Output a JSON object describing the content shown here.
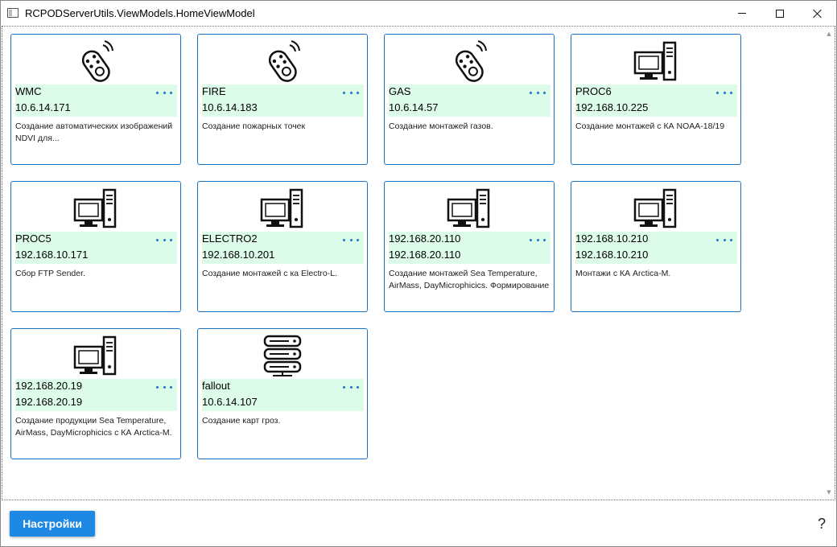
{
  "window": {
    "title": "RCPODServerUtils.ViewModels.HomeViewModel",
    "minimize_icon": "minimize-icon",
    "maximize_icon": "maximize-icon",
    "close_icon": "close-icon"
  },
  "cards": [
    {
      "icon": "remote-icon",
      "name": "WMC",
      "ip": "10.6.14.171",
      "description": "Создание автоматических изображений NDVI для..."
    },
    {
      "icon": "remote-icon",
      "name": "FIRE",
      "ip": "10.6.14.183",
      "description": "Создание пожарных точек"
    },
    {
      "icon": "remote-icon",
      "name": "GAS",
      "ip": "10.6.14.57",
      "description": "Создание монтажей газов."
    },
    {
      "icon": "computer-icon",
      "name": "PROC6",
      "ip": "192.168.10.225",
      "description": "Создание монтажей с КА NOAA-18/19"
    },
    {
      "icon": "computer-icon",
      "name": "PROC5",
      "ip": "192.168.10.171",
      "description": "Сбор FTP Sender."
    },
    {
      "icon": "computer-icon",
      "name": "ELECTRO2",
      "ip": "192.168.10.201",
      "description": "Создание монтажей с ка Electro-L."
    },
    {
      "icon": "computer-icon",
      "name": "192.168.20.110",
      "ip": "192.168.20.110",
      "description": "Создание монтажей Sea Temperature, AirMass, DayMicrophicics. Формирование"
    },
    {
      "icon": "computer-icon",
      "name": "192.168.10.210",
      "ip": "192.168.10.210",
      "description": "Монтажи с КА Arctica-M."
    },
    {
      "icon": "computer-icon",
      "name": "192.168.20.19",
      "ip": "192.168.20.19",
      "description": "Создание продукции Sea Temperature, AirMass, DayMicrophicics с КА Arctica-M."
    },
    {
      "icon": "server-icon",
      "name": "fallout",
      "ip": "10.6.14.107",
      "description": "Создание карт гроз."
    }
  ],
  "footer": {
    "settings_label": "Настройки",
    "help_label": "?"
  },
  "colors": {
    "accent": "#1e88e5",
    "card_border": "#1a73c7",
    "strip_bg": "#dcfbe9"
  }
}
